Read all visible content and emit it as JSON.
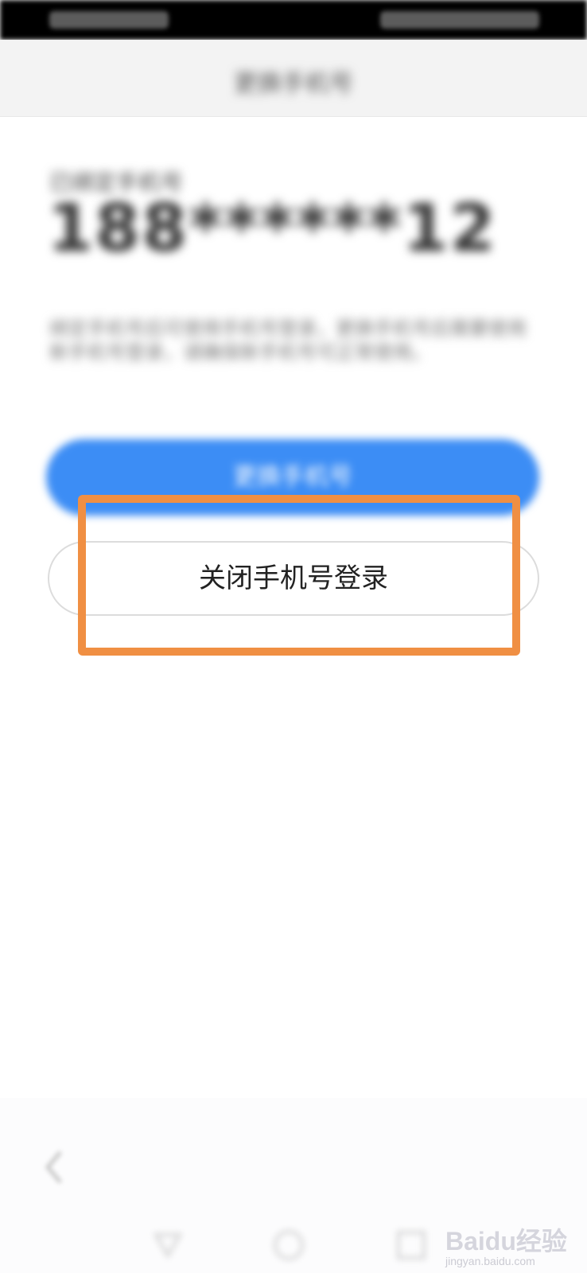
{
  "header": {
    "title": "更换手机号"
  },
  "account": {
    "bound_label": "已绑定手机号",
    "phone_number": "188******12",
    "description": "绑定手机号后可使用手机号登录，更换手机号后需要使用新手机号登录，请确保新手机号可正常使用。"
  },
  "actions": {
    "change_phone_label": "更换手机号",
    "close_login_label": "关闭手机号登录"
  },
  "watermark": {
    "brand": "Baidu经验",
    "sub": "jingyan.baidu.com"
  },
  "colors": {
    "primary_button": "#3c8df5",
    "highlight": "#f08f43"
  }
}
